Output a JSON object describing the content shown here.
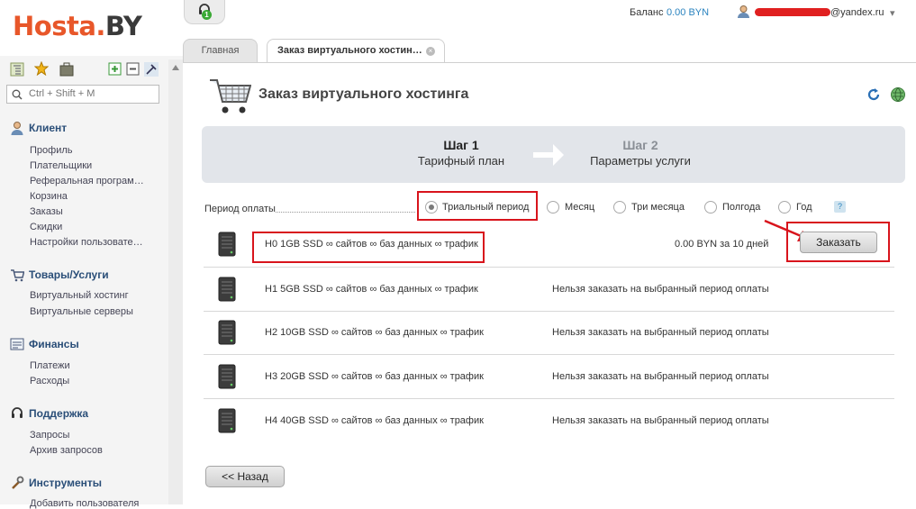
{
  "header": {
    "logo_part1": "Hosta.",
    "logo_part2": "BY",
    "support_badge": "1",
    "balance_label": "Баланс",
    "balance_value": "0.00 BYN",
    "user_email_domain": "@yandex.ru",
    "user_menu_arrow": "▾"
  },
  "tabs": {
    "main": "Главная",
    "order": "Заказ виртуального хостин…",
    "close_glyph": "×"
  },
  "sidebar": {
    "search_placeholder": "Ctrl + Shift + M",
    "sections": [
      {
        "title": "Клиент",
        "icon": "user-icon",
        "items": [
          "Профиль",
          "Плательщики",
          "Реферальная програм…",
          "Корзина",
          "Заказы",
          "Скидки",
          "Настройки пользовате…"
        ]
      },
      {
        "title": "Товары/Услуги",
        "icon": "cart-icon",
        "items": [
          "Виртуальный хостинг",
          "Виртуальные серверы"
        ]
      },
      {
        "title": "Финансы",
        "icon": "finance-icon",
        "items": [
          "Платежи",
          "Расходы"
        ]
      },
      {
        "title": "Поддержка",
        "icon": "headset-icon",
        "items": [
          "Запросы",
          "Архив запросов"
        ]
      },
      {
        "title": "Инструменты",
        "icon": "tools-icon",
        "items": [
          "Добавить пользователя"
        ]
      }
    ]
  },
  "main": {
    "title": "Заказ виртуального хостинга",
    "steps": [
      {
        "title": "Шаг 1",
        "subtitle": "Тарифный план"
      },
      {
        "title": "Шаг 2",
        "subtitle": "Параметры услуги"
      }
    ],
    "period_label": "Период оплаты",
    "periods": [
      "Триальный период",
      "Месяц",
      "Три месяца",
      "Полгода",
      "Год"
    ],
    "selected_period": "Триальный период",
    "help": "?",
    "plans": [
      {
        "name": "H0 1GB SSD ∞ сайтов ∞ баз данных ∞ трафик",
        "status": "0.00 BYN за 10 дней"
      },
      {
        "name": "H1 5GB SSD ∞ сайтов ∞ баз данных ∞ трафик",
        "status": "Нельзя заказать на выбранный период оплаты"
      },
      {
        "name": "H2 10GB SSD ∞ сайтов ∞ баз данных ∞ трафик",
        "status": "Нельзя заказать на выбранный период оплаты"
      },
      {
        "name": "H3 20GB SSD ∞ сайтов ∞ баз данных ∞ трафик",
        "status": "Нельзя заказать на выбранный период оплаты"
      },
      {
        "name": "H4 40GB SSD ∞ сайтов ∞ баз данных ∞ трафик",
        "status": "Нельзя заказать на выбранный период оплаты"
      }
    ],
    "order_button": "Заказать",
    "back_button": "<< Назад"
  },
  "colors": {
    "brand_orange": "#e8572a",
    "link_blue": "#2a83bf",
    "annotation_red": "#d8141c"
  }
}
